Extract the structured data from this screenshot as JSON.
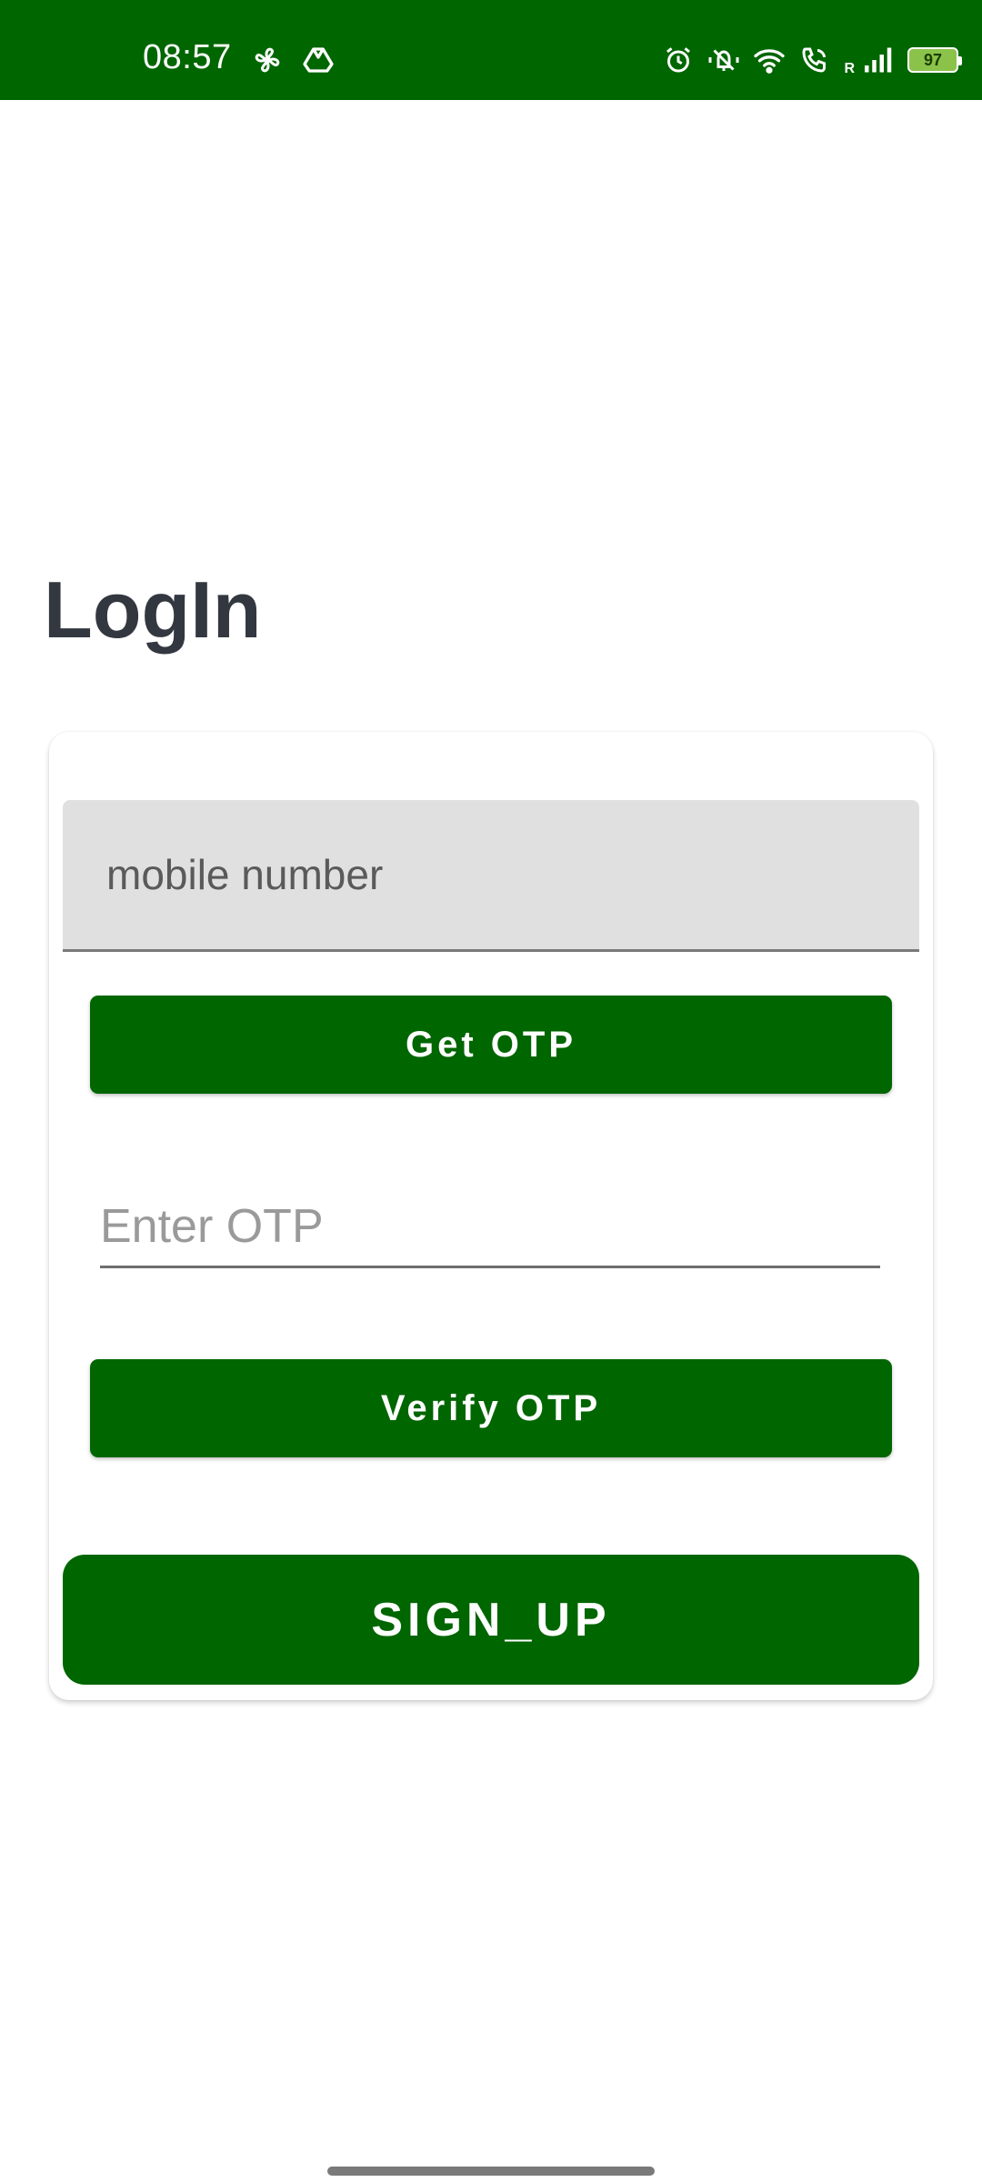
{
  "status_bar": {
    "time": "08:57",
    "roaming": "R",
    "battery": "97",
    "background_color": "#006600",
    "left_icons": [
      "fan-icon",
      "drive-icon"
    ],
    "right_icons": [
      "alarm-icon",
      "mute-icon",
      "wifi-icon",
      "wifi-call-icon",
      "signal-icon",
      "battery-icon"
    ]
  },
  "page": {
    "title": "LogIn"
  },
  "form": {
    "mobile_placeholder": "mobile number",
    "get_otp_label": "Get OTP",
    "otp_placeholder": "Enter OTP",
    "verify_otp_label": "Verify OTP",
    "sign_up_label": "SIGN_UP"
  },
  "colors": {
    "accent": "#006600",
    "title": "#333740",
    "field_background": "#e0e0e0"
  }
}
